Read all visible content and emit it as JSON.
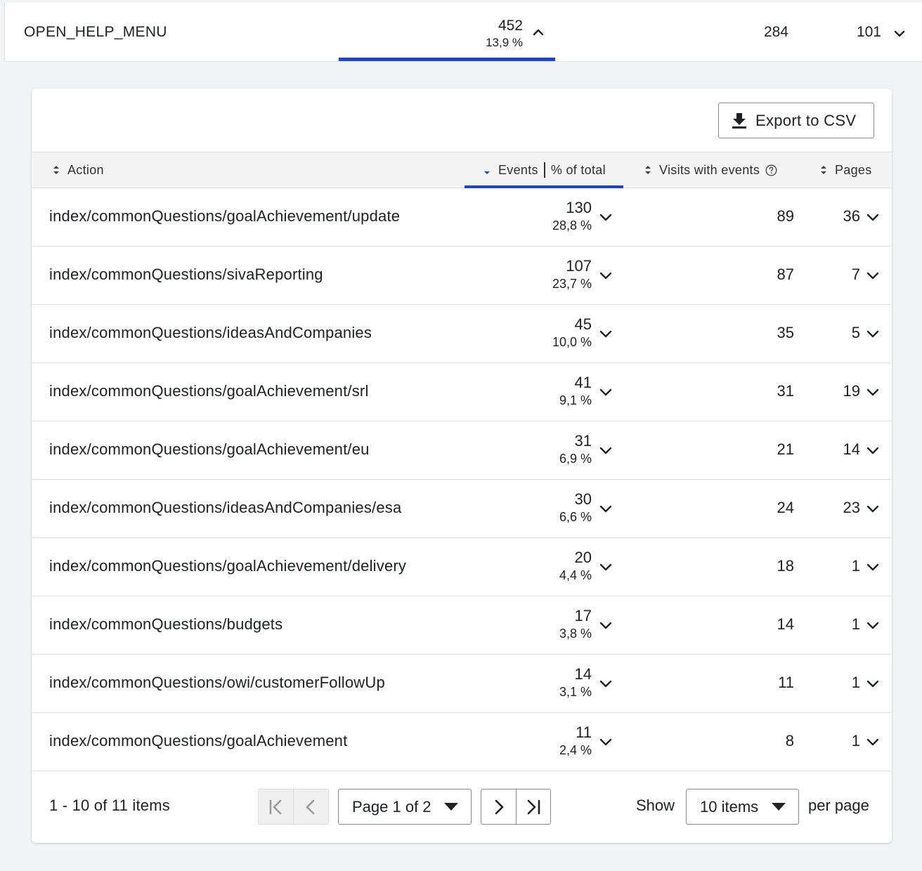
{
  "parent_row": {
    "action": "OPEN_HELP_MENU",
    "events": "452",
    "events_pct": "13,9 %",
    "visits": "284",
    "pages": "101"
  },
  "toolbar": {
    "export_label": "Export to CSV"
  },
  "columns": {
    "action": "Action",
    "events": "Events",
    "pct_total": "% of total",
    "visits": "Visits with events",
    "pages": "Pages"
  },
  "rows": [
    {
      "action": "index/commonQuestions/goalAchievement/update",
      "events": "130",
      "pct": "28,8 %",
      "visits": "89",
      "pages": "36"
    },
    {
      "action": "index/commonQuestions/sivaReporting",
      "events": "107",
      "pct": "23,7 %",
      "visits": "87",
      "pages": "7"
    },
    {
      "action": "index/commonQuestions/ideasAndCompanies",
      "events": "45",
      "pct": "10,0 %",
      "visits": "35",
      "pages": "5"
    },
    {
      "action": "index/commonQuestions/goalAchievement/srl",
      "events": "41",
      "pct": "9,1 %",
      "visits": "31",
      "pages": "19"
    },
    {
      "action": "index/commonQuestions/goalAchievement/eu",
      "events": "31",
      "pct": "6,9 %",
      "visits": "21",
      "pages": "14"
    },
    {
      "action": "index/commonQuestions/ideasAndCompanies/esa",
      "events": "30",
      "pct": "6,6 %",
      "visits": "24",
      "pages": "23"
    },
    {
      "action": "index/commonQuestions/goalAchievement/delivery",
      "events": "20",
      "pct": "4,4 %",
      "visits": "18",
      "pages": "1"
    },
    {
      "action": "index/commonQuestions/budgets",
      "events": "17",
      "pct": "3,8 %",
      "visits": "14",
      "pages": "1"
    },
    {
      "action": "index/commonQuestions/owi/customerFollowUp",
      "events": "14",
      "pct": "3,1 %",
      "visits": "11",
      "pages": "1"
    },
    {
      "action": "index/commonQuestions/goalAchievement",
      "events": "11",
      "pct": "2,4 %",
      "visits": "8",
      "pages": "1"
    }
  ],
  "pagination": {
    "count_label": "1 - 10 of 11 items",
    "page_label": "Page 1 of 2",
    "show_label": "Show",
    "items_label": "10 items",
    "per_page_label": "per page"
  },
  "colors": {
    "accent": "#1a44c9"
  },
  "icons": [
    "chevron-up-icon",
    "chevron-down-icon",
    "download-icon",
    "sort-icon",
    "sort-desc-icon",
    "help-icon",
    "first-page-icon",
    "prev-page-icon",
    "next-page-icon",
    "last-page-icon",
    "caret-down-icon"
  ]
}
